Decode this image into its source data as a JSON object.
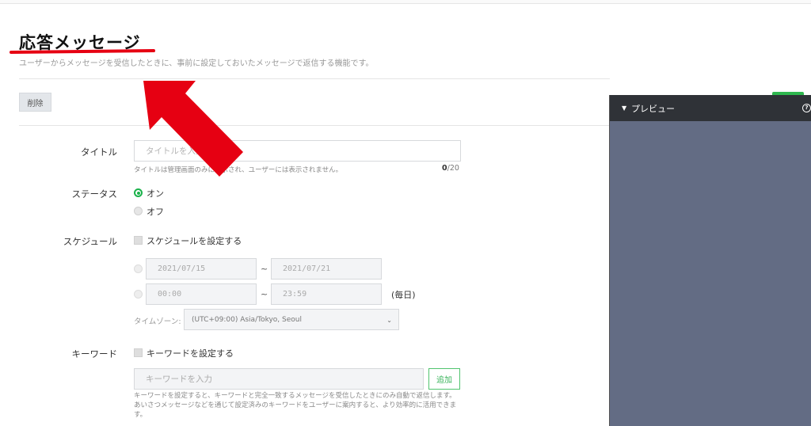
{
  "page": {
    "title": "応答メッセージ",
    "description": "ユーザーからメッセージを受信したときに、事前に設定しておいたメッセージで返信する機能です。"
  },
  "toolbar": {
    "delete_label": "削除"
  },
  "form": {
    "title": {
      "label": "タイトル",
      "placeholder": "タイトルを入力",
      "hint": "タイトルは管理画面のみに表示され、ユーザーには表示されません。",
      "count": "0",
      "max": "/20"
    },
    "status": {
      "label": "ステータス",
      "options": [
        "オン",
        "オフ"
      ],
      "selected": "オン"
    },
    "schedule": {
      "label": "スケジュール",
      "checkbox_label": "スケジュールを設定する",
      "date_start": "2021/07/15",
      "date_end": "2021/07/21",
      "time_start": "00:00",
      "time_end": "23:59",
      "separator": "~",
      "everyday": "(毎日)",
      "timezone_label": "タイムゾーン:",
      "timezone_value": "(UTC+09:00) Asia/Tokyo, Seoul"
    },
    "keyword": {
      "label": "キーワード",
      "checkbox_label": "キーワードを設定する",
      "placeholder": "キーワードを入力",
      "add_label": "追加",
      "description": "キーワードを設定すると、キーワードと完全一致するメッセージを受信したときにのみ自動で返信します。あいさつメッセージなどを通じて設定済みのキーワードをユーザーに案内すると、より効率的に活用できます。"
    }
  },
  "preview": {
    "title": "プレビュー",
    "help_icon": "question-circle-icon"
  },
  "colors": {
    "accent_green": "#1bb24b",
    "annotation_red": "#e60012",
    "preview_bg": "#636c84",
    "preview_header": "#2f3237"
  }
}
